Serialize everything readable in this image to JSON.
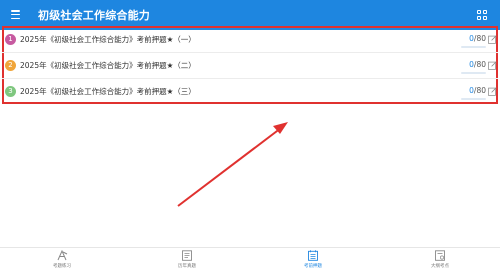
{
  "header": {
    "title": "初级社会工作综合能力",
    "menu_icon": "menu-icon",
    "right_icon": "grid-icon",
    "background": "#1e86e0"
  },
  "list": [
    {
      "num": "1",
      "color": "#c75aa0",
      "title": "2025年《初级社会工作综合能力》考前押题★（一）",
      "done": "0",
      "total": "/80",
      "progress": 0
    },
    {
      "num": "2",
      "color": "#f0a53a",
      "title": "2025年《初级社会工作综合能力》考前押题★（二）",
      "done": "0",
      "total": "/80",
      "progress": 0
    },
    {
      "num": "3",
      "color": "#7fc77f",
      "title": "2025年《初级社会工作综合能力》考前押题★（三）",
      "done": "0",
      "total": "/80",
      "progress": 0
    }
  ],
  "bottom_nav": [
    {
      "label": "考题练习",
      "icon": "exam-practice-icon",
      "active": false
    },
    {
      "label": "历年真题",
      "icon": "past-papers-icon",
      "active": false
    },
    {
      "label": "考前押题",
      "icon": "pre-exam-icon",
      "active": true
    },
    {
      "label": "大纲考点",
      "icon": "syllabus-icon",
      "active": false
    }
  ],
  "annotation": {
    "highlight_color": "#e0312f"
  }
}
